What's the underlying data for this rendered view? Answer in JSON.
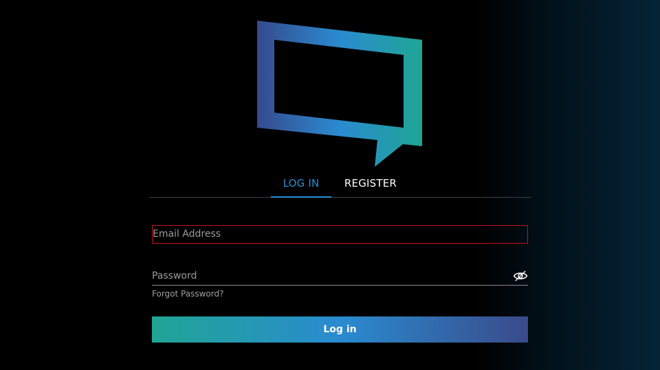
{
  "brand": {
    "logo_icon": "speech-bubble-logo-icon",
    "gradient": [
      "#3a4a8a",
      "#2a8bd0",
      "#1fa595"
    ]
  },
  "tabs": [
    {
      "label": "LOG IN",
      "active": true
    },
    {
      "label": "REGISTER",
      "active": false
    }
  ],
  "form": {
    "email_placeholder": "Email Address",
    "password_placeholder": "Password",
    "password_toggle_icon": "eye-slash-icon",
    "forgot_label": "Forgot Password?",
    "submit_label": "Log in"
  },
  "colors": {
    "accent": "#2a8fd6",
    "error_border": "#c4121f",
    "background": "#000000"
  }
}
